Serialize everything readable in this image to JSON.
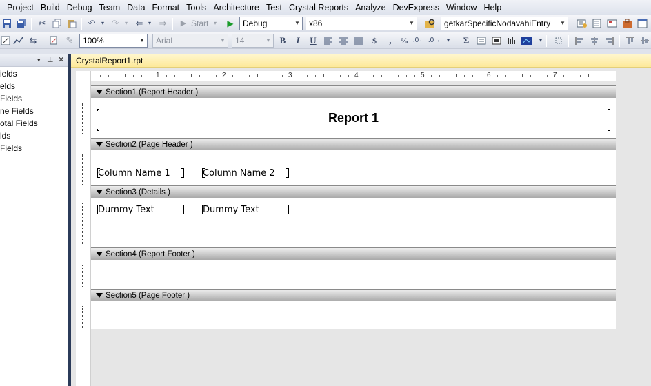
{
  "menu": [
    "Project",
    "Build",
    "Debug",
    "Team",
    "Data",
    "Format",
    "Tools",
    "Architecture",
    "Test",
    "Crystal Reports",
    "Analyze",
    "DevExpress",
    "Window",
    "Help"
  ],
  "toolbar1": {
    "start_label": "Start",
    "configuration": "Debug",
    "platform": "x86",
    "find_combo": "getkarSpecificNodavahiEntry"
  },
  "toolbar2": {
    "zoom": "100%",
    "font": "Arial",
    "font_size": "14",
    "bold_glyph": "B",
    "italic_glyph": "I",
    "underline_glyph": "U",
    "comma_glyph": ",",
    "percent_glyph": "%",
    "sigma_glyph": "Σ"
  },
  "left_panel": {
    "controls": {
      "dropdown": "▾",
      "pin": "⊥",
      "close": "✕"
    },
    "items": [
      "ields",
      "elds",
      "Fields",
      "ne Fields",
      "otal Fields",
      "lds",
      "Fields"
    ]
  },
  "document": {
    "tab_title": "CrystalReport1.rpt",
    "ruler_numbers": [
      "1",
      "2",
      "3",
      "4",
      "5",
      "6",
      "7"
    ],
    "sections": [
      {
        "label": "Section1 (Report Header )"
      },
      {
        "label": "Section2 (Page Header )"
      },
      {
        "label": "Section3 (Details )"
      },
      {
        "label": "Section4 (Report Footer )"
      },
      {
        "label": "Section5 (Page Footer )"
      }
    ],
    "report_title": "Report 1",
    "column_headers": [
      "Column Name 1",
      "Column Name 2"
    ],
    "detail_fields": [
      "Dummy Text",
      "Dummy Text"
    ]
  },
  "colors": {
    "splitter": "#2b3b59",
    "tab_active": "#fde99a",
    "section_bar": "#c8c8c8",
    "canvas": "#e6e6e6"
  }
}
